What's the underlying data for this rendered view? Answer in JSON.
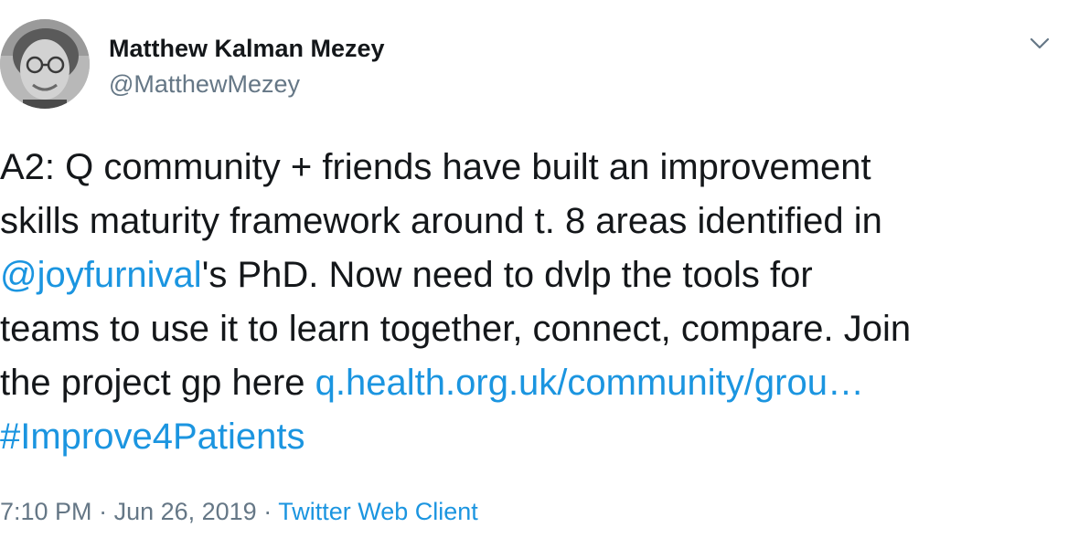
{
  "author": {
    "name": "Matthew Kalman Mezey",
    "handle": "@MatthewMezey"
  },
  "tweet": {
    "line1": "A2: Q community + friends have built an improvement",
    "line2": "skills maturity framework around t. 8 areas identified in",
    "line3_mention": "@joyfurnival",
    "line3_rest": "'s PhD. Now need to dvlp the tools for",
    "line4": "teams to use it to learn together, connect, compare. Join",
    "line5_prefix": "the project gp here ",
    "line5_link": "q.health.org.uk/community/grou…",
    "line6_hashtag": "#Improve4Patients"
  },
  "meta": {
    "time": "7:10 PM",
    "separator1": " · ",
    "date": "Jun 26, 2019",
    "separator2": " · ",
    "source": "Twitter Web Client"
  },
  "icons": {
    "menu": "chevron-down-icon"
  },
  "colors": {
    "text": "#14171a",
    "secondary": "#657786",
    "link": "#1b95e0"
  }
}
